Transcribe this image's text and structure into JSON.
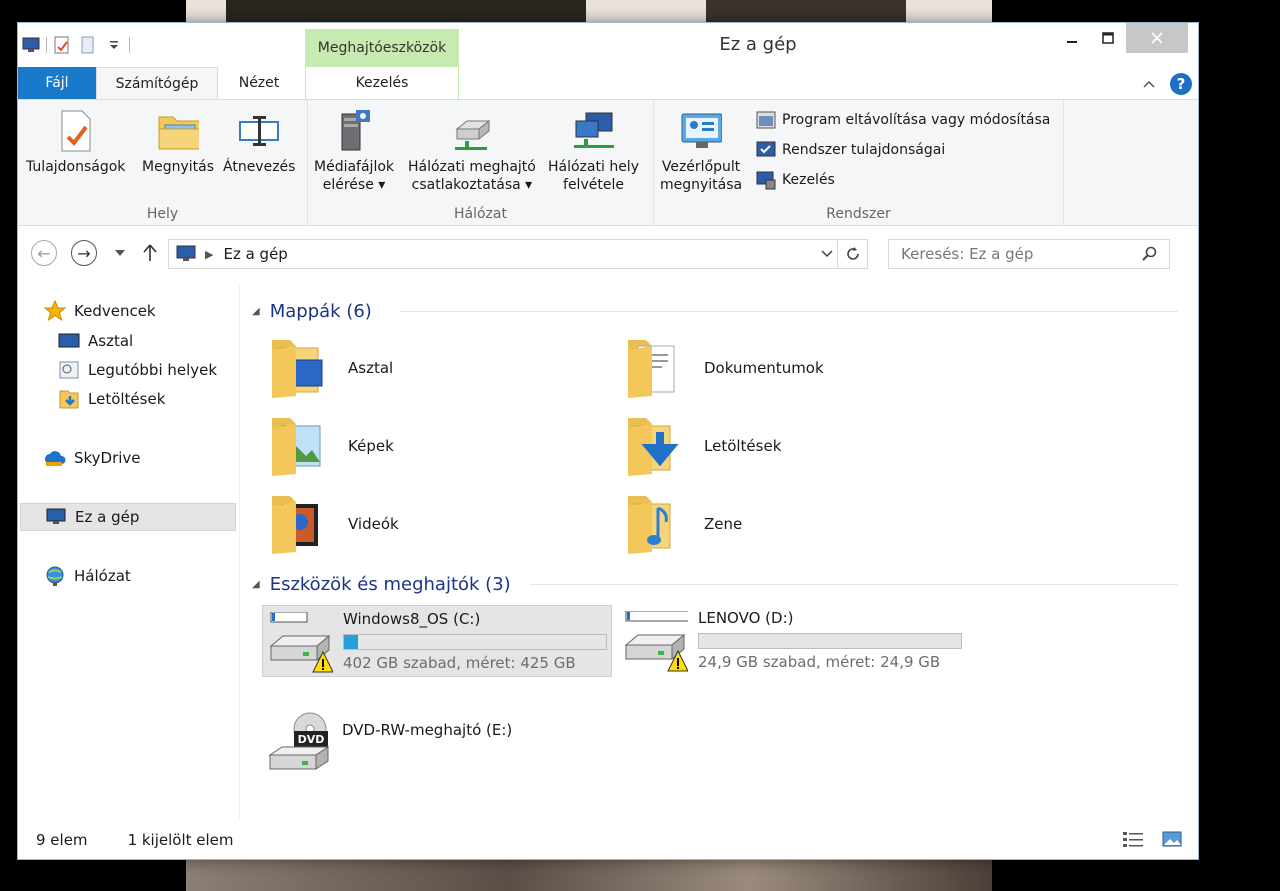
{
  "window": {
    "title": "Ez a gép"
  },
  "quick_access": {
    "icons": [
      "computer-icon",
      "properties-icon",
      "new-folder-icon",
      "customize-dropdown-icon"
    ]
  },
  "ribbon_tabs": {
    "file": "Fájl",
    "computer": "Számítógép",
    "view": "Nézet",
    "context_group": "Meghajtóeszközök",
    "manage": "Kezelés"
  },
  "ribbon": {
    "location": {
      "label": "Hely",
      "properties": "Tulajdonságok",
      "open": "Megnyitás",
      "rename": "Átnevezés"
    },
    "network": {
      "label": "Hálózat",
      "media_line1": "Médiafájlok",
      "media_line2": "elérése",
      "map_line1": "Hálózati meghajtó",
      "map_line2": "csatlakoztatása",
      "add_line1": "Hálózati hely",
      "add_line2": "felvétele"
    },
    "system": {
      "label": "Rendszer",
      "cp_line1": "Vezérlőpult",
      "cp_line2": "megnyitása",
      "uninstall": "Program eltávolítása vagy módosítása",
      "sysprops": "Rendszer tulajdonságai",
      "manage": "Kezelés"
    }
  },
  "address_bar": {
    "path": "Ez a gép",
    "search_placeholder": "Keresés: Ez a gép"
  },
  "nav_pane": {
    "favorites": "Kedvencek",
    "desktop": "Asztal",
    "recent": "Legutóbbi helyek",
    "downloads": "Letöltések",
    "skydrive": "SkyDrive",
    "this_pc": "Ez a gép",
    "network": "Hálózat"
  },
  "folders_section": {
    "title": "Mappák (6)",
    "items": [
      "Asztal",
      "Dokumentumok",
      "Képek",
      "Letöltések",
      "Videók",
      "Zene"
    ]
  },
  "drives_section": {
    "title": "Eszközök és meghajtók (3)",
    "drives": [
      {
        "name": "Windows8_OS (C:)",
        "free": "402 GB szabad, méret: 425 GB",
        "used_fraction": 0.054
      },
      {
        "name": "LENOVO (D:)",
        "free": "24,9 GB szabad, méret: 24,9 GB",
        "used_fraction": 0.0
      },
      {
        "name": "DVD-RW-meghajtó (E:)",
        "badge": "DVD"
      }
    ]
  },
  "status_bar": {
    "count": "9 elem",
    "selected": "1 kijelölt elem"
  },
  "colors": {
    "accent": "#1979ca",
    "context_tab": "#c6ebb0",
    "progress": "#26a0da",
    "section_heading": "#1e3287"
  }
}
